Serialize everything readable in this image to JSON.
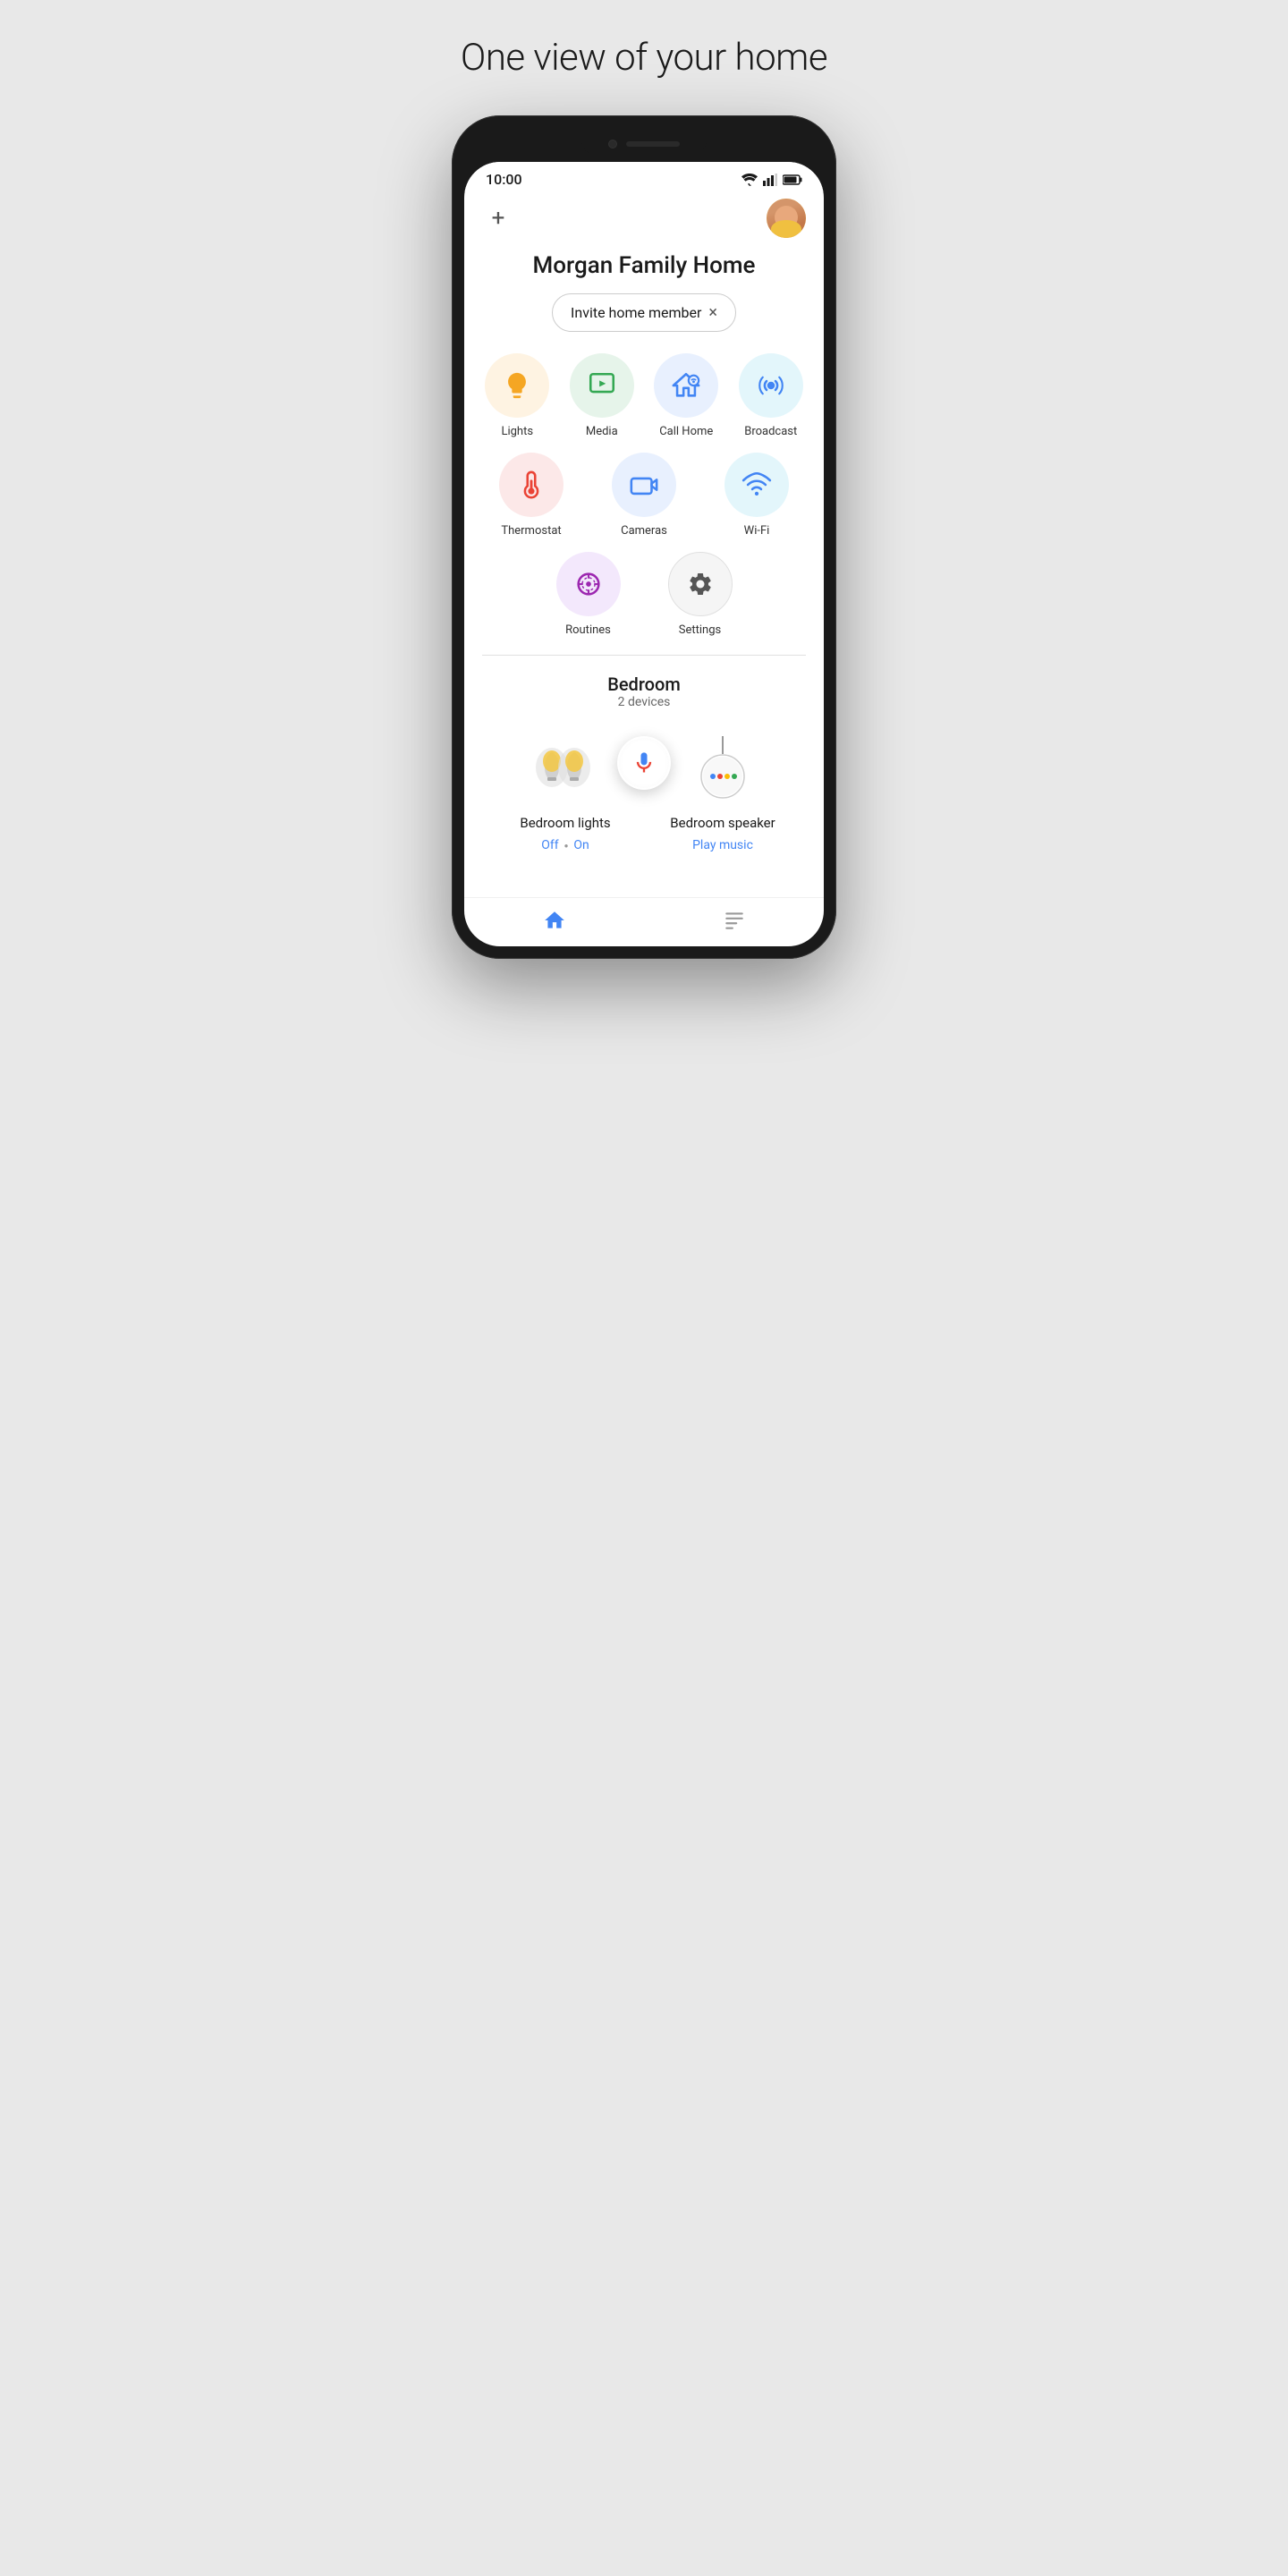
{
  "page": {
    "title": "One view of your home"
  },
  "statusBar": {
    "time": "10:00"
  },
  "header": {
    "addLabel": "+",
    "homeName": "Morgan Family Home"
  },
  "inviteBanner": {
    "label": "Invite home member",
    "closeIcon": "×"
  },
  "shortcuts": {
    "row1": [
      {
        "id": "lights",
        "label": "Lights",
        "bgColor": "#fef3e2",
        "iconColor": "#f5a623"
      },
      {
        "id": "media",
        "label": "Media",
        "bgColor": "#e6f4ea",
        "iconColor": "#34a853"
      },
      {
        "id": "call-home",
        "label": "Call Home",
        "bgColor": "#e8f0fe",
        "iconColor": "#4285f4"
      },
      {
        "id": "broadcast",
        "label": "Broadcast",
        "bgColor": "#e3f6fb",
        "iconColor": "#4285f4"
      }
    ],
    "row2": [
      {
        "id": "thermostat",
        "label": "Thermostat",
        "bgColor": "#fce8e8",
        "iconColor": "#ea4335"
      },
      {
        "id": "cameras",
        "label": "Cameras",
        "bgColor": "#e8f0fe",
        "iconColor": "#4285f4"
      },
      {
        "id": "wifi",
        "label": "Wi-Fi",
        "bgColor": "#e3f6fb",
        "iconColor": "#4285f4"
      }
    ],
    "row3": [
      {
        "id": "routines",
        "label": "Routines",
        "bgColor": "#f3e8fc",
        "iconColor": "#9c27b0"
      },
      {
        "id": "settings",
        "label": "Settings",
        "bgColor": "#f5f5f5",
        "iconColor": "#555"
      }
    ]
  },
  "room": {
    "name": "Bedroom",
    "deviceCount": "2 devices",
    "devices": [
      {
        "id": "bedroom-lights",
        "name": "Bedroom lights",
        "statusOff": "Off",
        "statusOn": "On"
      },
      {
        "id": "bedroom-speaker",
        "name": "Bedroom speaker",
        "action": "Play music"
      }
    ]
  },
  "bottomNav": [
    {
      "id": "home",
      "icon": "home-icon"
    },
    {
      "id": "list",
      "icon": "list-icon"
    }
  ],
  "colors": {
    "googleBlue": "#4285f4",
    "googleRed": "#ea4335",
    "googleGreen": "#34a853",
    "googleYellow": "#fbbc04"
  }
}
